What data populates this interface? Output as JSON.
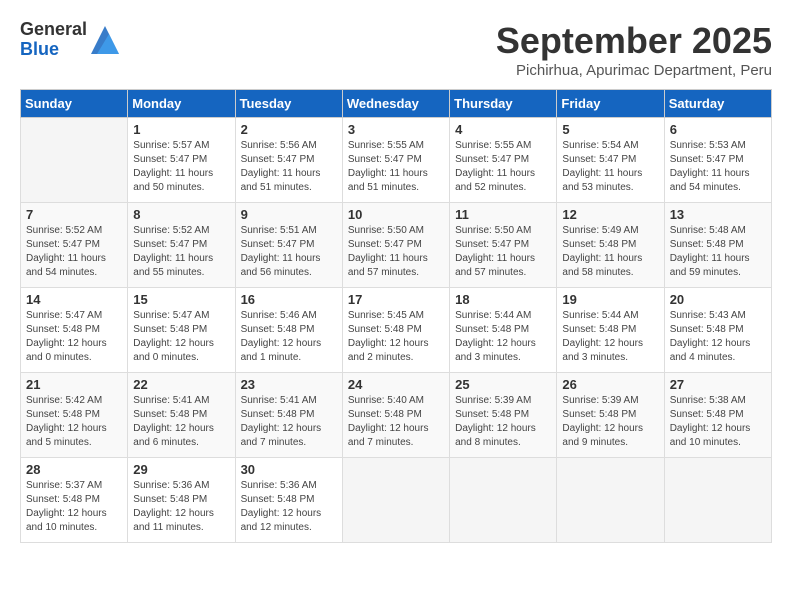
{
  "header": {
    "logo_general": "General",
    "logo_blue": "Blue",
    "month_title": "September 2025",
    "subtitle": "Pichirhua, Apurimac Department, Peru"
  },
  "days_of_week": [
    "Sunday",
    "Monday",
    "Tuesday",
    "Wednesday",
    "Thursday",
    "Friday",
    "Saturday"
  ],
  "weeks": [
    [
      {
        "day": "",
        "info": ""
      },
      {
        "day": "1",
        "info": "Sunrise: 5:57 AM\nSunset: 5:47 PM\nDaylight: 11 hours\nand 50 minutes."
      },
      {
        "day": "2",
        "info": "Sunrise: 5:56 AM\nSunset: 5:47 PM\nDaylight: 11 hours\nand 51 minutes."
      },
      {
        "day": "3",
        "info": "Sunrise: 5:55 AM\nSunset: 5:47 PM\nDaylight: 11 hours\nand 51 minutes."
      },
      {
        "day": "4",
        "info": "Sunrise: 5:55 AM\nSunset: 5:47 PM\nDaylight: 11 hours\nand 52 minutes."
      },
      {
        "day": "5",
        "info": "Sunrise: 5:54 AM\nSunset: 5:47 PM\nDaylight: 11 hours\nand 53 minutes."
      },
      {
        "day": "6",
        "info": "Sunrise: 5:53 AM\nSunset: 5:47 PM\nDaylight: 11 hours\nand 54 minutes."
      }
    ],
    [
      {
        "day": "7",
        "info": "Sunrise: 5:52 AM\nSunset: 5:47 PM\nDaylight: 11 hours\nand 54 minutes."
      },
      {
        "day": "8",
        "info": "Sunrise: 5:52 AM\nSunset: 5:47 PM\nDaylight: 11 hours\nand 55 minutes."
      },
      {
        "day": "9",
        "info": "Sunrise: 5:51 AM\nSunset: 5:47 PM\nDaylight: 11 hours\nand 56 minutes."
      },
      {
        "day": "10",
        "info": "Sunrise: 5:50 AM\nSunset: 5:47 PM\nDaylight: 11 hours\nand 57 minutes."
      },
      {
        "day": "11",
        "info": "Sunrise: 5:50 AM\nSunset: 5:47 PM\nDaylight: 11 hours\nand 57 minutes."
      },
      {
        "day": "12",
        "info": "Sunrise: 5:49 AM\nSunset: 5:48 PM\nDaylight: 11 hours\nand 58 minutes."
      },
      {
        "day": "13",
        "info": "Sunrise: 5:48 AM\nSunset: 5:48 PM\nDaylight: 11 hours\nand 59 minutes."
      }
    ],
    [
      {
        "day": "14",
        "info": "Sunrise: 5:47 AM\nSunset: 5:48 PM\nDaylight: 12 hours\nand 0 minutes."
      },
      {
        "day": "15",
        "info": "Sunrise: 5:47 AM\nSunset: 5:48 PM\nDaylight: 12 hours\nand 0 minutes."
      },
      {
        "day": "16",
        "info": "Sunrise: 5:46 AM\nSunset: 5:48 PM\nDaylight: 12 hours\nand 1 minute."
      },
      {
        "day": "17",
        "info": "Sunrise: 5:45 AM\nSunset: 5:48 PM\nDaylight: 12 hours\nand 2 minutes."
      },
      {
        "day": "18",
        "info": "Sunrise: 5:44 AM\nSunset: 5:48 PM\nDaylight: 12 hours\nand 3 minutes."
      },
      {
        "day": "19",
        "info": "Sunrise: 5:44 AM\nSunset: 5:48 PM\nDaylight: 12 hours\nand 3 minutes."
      },
      {
        "day": "20",
        "info": "Sunrise: 5:43 AM\nSunset: 5:48 PM\nDaylight: 12 hours\nand 4 minutes."
      }
    ],
    [
      {
        "day": "21",
        "info": "Sunrise: 5:42 AM\nSunset: 5:48 PM\nDaylight: 12 hours\nand 5 minutes."
      },
      {
        "day": "22",
        "info": "Sunrise: 5:41 AM\nSunset: 5:48 PM\nDaylight: 12 hours\nand 6 minutes."
      },
      {
        "day": "23",
        "info": "Sunrise: 5:41 AM\nSunset: 5:48 PM\nDaylight: 12 hours\nand 7 minutes."
      },
      {
        "day": "24",
        "info": "Sunrise: 5:40 AM\nSunset: 5:48 PM\nDaylight: 12 hours\nand 7 minutes."
      },
      {
        "day": "25",
        "info": "Sunrise: 5:39 AM\nSunset: 5:48 PM\nDaylight: 12 hours\nand 8 minutes."
      },
      {
        "day": "26",
        "info": "Sunrise: 5:39 AM\nSunset: 5:48 PM\nDaylight: 12 hours\nand 9 minutes."
      },
      {
        "day": "27",
        "info": "Sunrise: 5:38 AM\nSunset: 5:48 PM\nDaylight: 12 hours\nand 10 minutes."
      }
    ],
    [
      {
        "day": "28",
        "info": "Sunrise: 5:37 AM\nSunset: 5:48 PM\nDaylight: 12 hours\nand 10 minutes."
      },
      {
        "day": "29",
        "info": "Sunrise: 5:36 AM\nSunset: 5:48 PM\nDaylight: 12 hours\nand 11 minutes."
      },
      {
        "day": "30",
        "info": "Sunrise: 5:36 AM\nSunset: 5:48 PM\nDaylight: 12 hours\nand 12 minutes."
      },
      {
        "day": "",
        "info": ""
      },
      {
        "day": "",
        "info": ""
      },
      {
        "day": "",
        "info": ""
      },
      {
        "day": "",
        "info": ""
      }
    ]
  ]
}
